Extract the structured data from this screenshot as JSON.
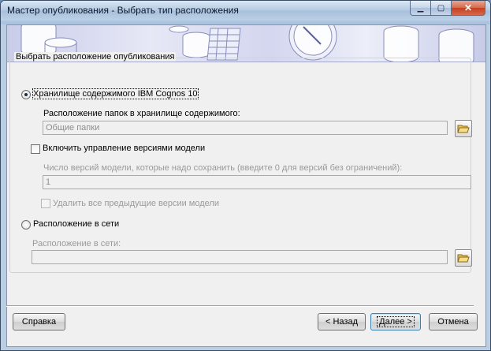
{
  "window": {
    "title": "Мастер опубликования - Выбрать тип расположения",
    "min_glyph": "▁",
    "max_glyph": "▢",
    "close_glyph": "✕"
  },
  "group": {
    "legend": "Выбрать расположение опубликования"
  },
  "content_store": {
    "radio_label": "Хранилище содержимого IBM Cognos 10",
    "selected": true,
    "folder_label": "Расположение папок в хранилище содержимого:",
    "folder_value": "Общие папки",
    "versioning_label": "Включить управление версиями модели",
    "versioning_checked": false,
    "versions_label": "Число версий модели, которые надо сохранить (введите 0 для версий без ограничений):",
    "versions_value": "1",
    "delete_label": "Удалить все предыдущие версии модели",
    "delete_checked": false
  },
  "network": {
    "radio_label": "Расположение в сети",
    "selected": false,
    "location_label": "Расположение в сети:",
    "location_value": ""
  },
  "footer": {
    "help_label": "Справка",
    "back_label": "< Назад",
    "next_label": "Далее >",
    "cancel_label": "Отмена"
  },
  "colors": {
    "accent": "#3c7fb1",
    "disabled_text": "#9a9a9a"
  }
}
